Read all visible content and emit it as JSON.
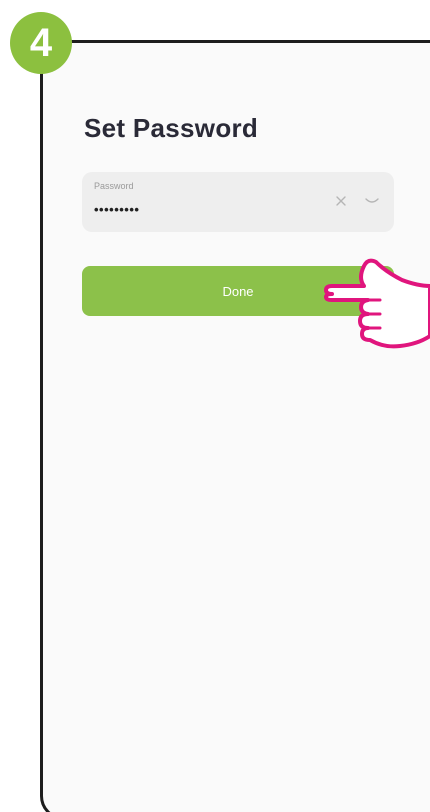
{
  "step": {
    "number": "4",
    "color": "#8cc03f"
  },
  "screen": {
    "title": "Set Password"
  },
  "password_field": {
    "label": "Password",
    "value": "•••••••••",
    "clear_icon": "close-icon",
    "visibility_icon": "eye-closed-icon"
  },
  "done_button": {
    "label": "Done",
    "color": "#8cc14a"
  },
  "pointer": {
    "icon": "hand-pointer-icon",
    "color": "#e0157d"
  }
}
